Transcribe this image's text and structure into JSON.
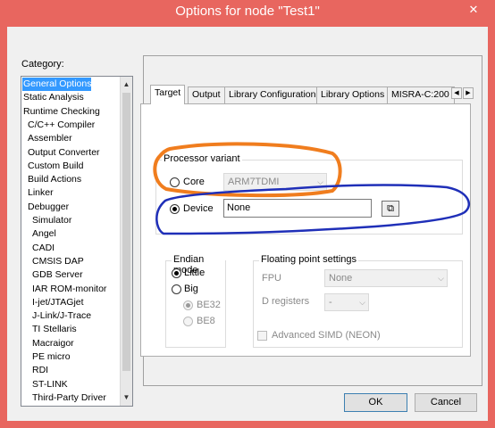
{
  "window": {
    "title": "Options for node \"Test1\"",
    "close_glyph": "✕"
  },
  "category": {
    "label": "Category:",
    "items": [
      {
        "label": "General Options",
        "indent": false,
        "selected": true
      },
      {
        "label": "Static Analysis",
        "indent": false,
        "selected": false
      },
      {
        "label": "Runtime Checking",
        "indent": false,
        "selected": false
      },
      {
        "label": "C/C++ Compiler",
        "indent": true,
        "selected": false
      },
      {
        "label": "Assembler",
        "indent": true,
        "selected": false
      },
      {
        "label": "Output Converter",
        "indent": true,
        "selected": false
      },
      {
        "label": "Custom Build",
        "indent": true,
        "selected": false
      },
      {
        "label": "Build Actions",
        "indent": true,
        "selected": false
      },
      {
        "label": "Linker",
        "indent": true,
        "selected": false
      },
      {
        "label": "Debugger",
        "indent": true,
        "selected": false
      },
      {
        "label": "Simulator",
        "indent": true,
        "sub": true,
        "selected": false
      },
      {
        "label": "Angel",
        "indent": true,
        "sub": true,
        "selected": false
      },
      {
        "label": "CADI",
        "indent": true,
        "sub": true,
        "selected": false
      },
      {
        "label": "CMSIS DAP",
        "indent": true,
        "sub": true,
        "selected": false
      },
      {
        "label": "GDB Server",
        "indent": true,
        "sub": true,
        "selected": false
      },
      {
        "label": "IAR ROM-monitor",
        "indent": true,
        "sub": true,
        "selected": false
      },
      {
        "label": "I-jet/JTAGjet",
        "indent": true,
        "sub": true,
        "selected": false
      },
      {
        "label": "J-Link/J-Trace",
        "indent": true,
        "sub": true,
        "selected": false
      },
      {
        "label": "TI Stellaris",
        "indent": true,
        "sub": true,
        "selected": false
      },
      {
        "label": "Macraigor",
        "indent": true,
        "sub": true,
        "selected": false
      },
      {
        "label": "PE micro",
        "indent": true,
        "sub": true,
        "selected": false
      },
      {
        "label": "RDI",
        "indent": true,
        "sub": true,
        "selected": false
      },
      {
        "label": "ST-LINK",
        "indent": true,
        "sub": true,
        "selected": false
      },
      {
        "label": "Third-Party Driver",
        "indent": true,
        "sub": true,
        "selected": false
      }
    ]
  },
  "tabs": [
    {
      "label": "Target",
      "active": true
    },
    {
      "label": "Output",
      "active": false
    },
    {
      "label": "Library Configuration",
      "active": false
    },
    {
      "label": "Library Options",
      "active": false
    },
    {
      "label": "MISRA-C:200",
      "active": false
    }
  ],
  "processor_variant": {
    "title": "Processor variant",
    "core_label": "Core",
    "core_value": "ARM7TDMI",
    "device_label": "Device",
    "device_value": "None",
    "selected": "device"
  },
  "endian_mode": {
    "title": "Endian mode",
    "little": "Little",
    "big": "Big",
    "be32": "BE32",
    "be8": "BE8",
    "selected": "little"
  },
  "floating_point": {
    "title": "Floating point settings",
    "fpu_label": "FPU",
    "fpu_value": "None",
    "dregs_label": "D registers",
    "dregs_value": "-",
    "simd_label": "Advanced SIMD (NEON)"
  },
  "buttons": {
    "ok": "OK",
    "cancel": "Cancel"
  },
  "colors": {
    "titlebar": "#e8665f",
    "selection": "#3399ff",
    "annotation_orange": "#f07d1e",
    "annotation_blue": "#1f2fb8"
  },
  "icons": {
    "close": "close-icon",
    "scroll_up": "chevron-up-icon",
    "scroll_down": "chevron-down-icon",
    "tab_left": "chevron-left-icon",
    "tab_right": "chevron-right-icon",
    "device_picker": "device-picker-icon"
  }
}
